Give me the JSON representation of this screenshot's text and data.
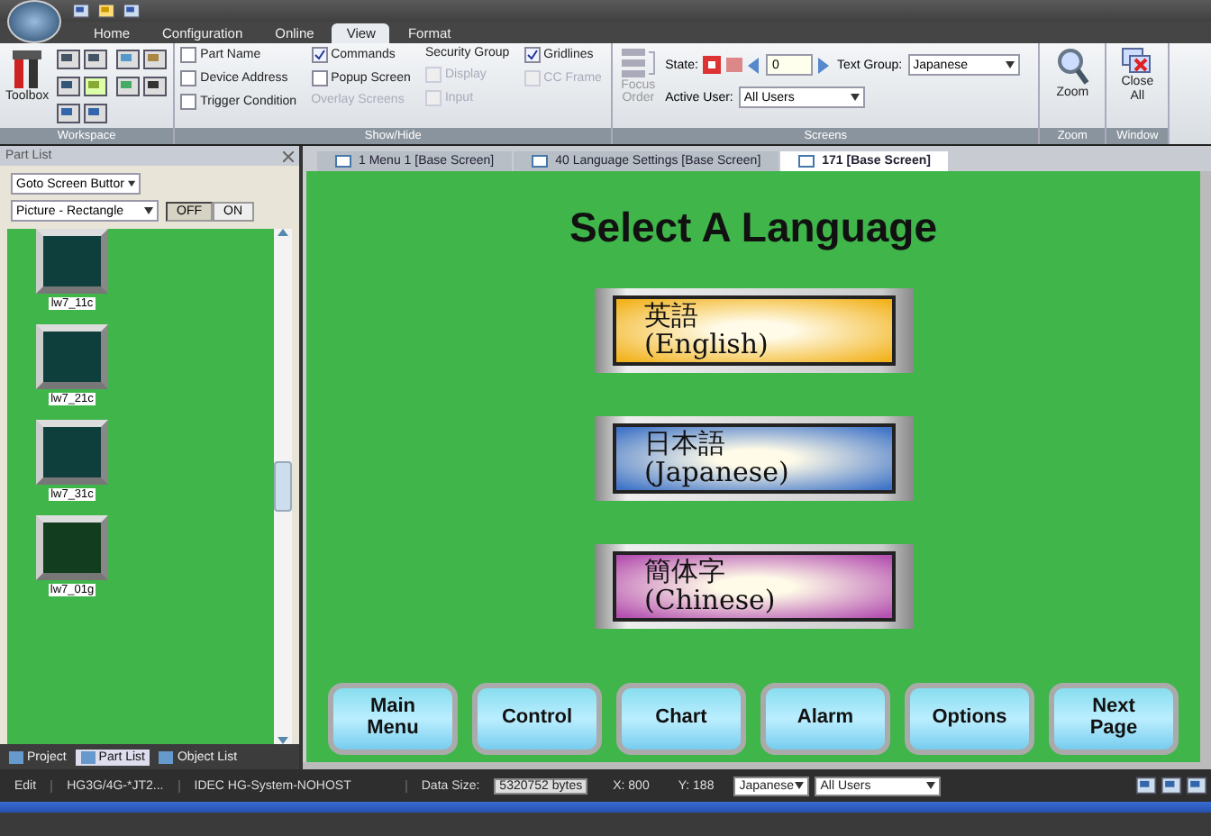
{
  "ribbon_tabs": [
    {
      "label": "Home",
      "selected": false
    },
    {
      "label": "Configuration",
      "selected": false
    },
    {
      "label": "Online",
      "selected": false
    },
    {
      "label": "View",
      "selected": true
    },
    {
      "label": "Format",
      "selected": false
    }
  ],
  "ribbon": {
    "workspace": {
      "toolbox": "Toolbox",
      "group_label": "Workspace"
    },
    "show_hide": {
      "group_label": "Show/Hide",
      "columns": [
        [
          {
            "kind": "checkbox",
            "label": "Part Name",
            "checked": false,
            "disabled": false
          },
          {
            "kind": "checkbox",
            "label": "Device Address",
            "checked": false,
            "disabled": false
          },
          {
            "kind": "checkbox",
            "label": "Trigger Condition",
            "checked": false,
            "disabled": false
          }
        ],
        [
          {
            "kind": "checkbox",
            "label": "Commands",
            "checked": true,
            "disabled": false
          },
          {
            "kind": "checkbox",
            "label": "Popup Screen",
            "checked": false,
            "disabled": false
          },
          {
            "kind": "label",
            "label": "Overlay Screens",
            "disabled": true
          }
        ],
        [
          {
            "kind": "label",
            "label": "Security Group",
            "disabled": false
          },
          {
            "kind": "checkbox",
            "label": "Display",
            "checked": false,
            "disabled": true
          },
          {
            "kind": "checkbox",
            "label": "Input",
            "checked": false,
            "disabled": true
          }
        ],
        [
          {
            "kind": "checkbox",
            "label": "Gridlines",
            "checked": true,
            "disabled": false
          },
          {
            "kind": "checkbox",
            "label": "CC Frame",
            "checked": false,
            "disabled": true
          }
        ]
      ]
    },
    "screens": {
      "group_label": "Screens",
      "focus_order": "Focus Order",
      "state_label": "State:",
      "state_value": "0",
      "text_group_label": "Text Group:",
      "text_group": "Japanese",
      "active_user_label": "Active User:",
      "active_user": "All Users"
    },
    "zoom": {
      "button": "Zoom",
      "group_label": "Zoom"
    },
    "window": {
      "button": "Close All",
      "group_label": "Window"
    }
  },
  "part_list": {
    "title": "Part List",
    "category": "Goto Screen Buttor",
    "shape": "Picture - Rectangle",
    "toggle": [
      {
        "label": "OFF",
        "selected": true
      },
      {
        "label": "ON",
        "selected": false
      }
    ],
    "parts": [
      {
        "name": "lw7_11c",
        "color": "#0f3f3c"
      },
      {
        "name": "lw7_21c",
        "color": "#0f3f3c"
      },
      {
        "name": "lw7_31c",
        "color": "#0f3f3c"
      },
      {
        "name": "lw7_01g",
        "color": "#123d1e"
      }
    ]
  },
  "panel_tabs": [
    {
      "label": "Project",
      "selected": false
    },
    {
      "label": "Part List",
      "selected": true
    },
    {
      "label": "Object List",
      "selected": false
    }
  ],
  "doc_tabs": [
    {
      "label": "1 Menu 1 [Base Screen]",
      "selected": false
    },
    {
      "label": "40 Language Settings [Base Screen]",
      "selected": false
    },
    {
      "label": "171  [Base Screen]",
      "selected": true
    }
  ],
  "screen": {
    "title": "Select A Language",
    "languages": [
      {
        "native": "英語",
        "english": "(English)",
        "color": "#f2b21c"
      },
      {
        "native": "日本語",
        "english": "(Japanese)",
        "color": "#3f74c8"
      },
      {
        "native": "簡体字",
        "english": "(Chinese)",
        "color": "#b450b0"
      }
    ],
    "nav_buttons": [
      [
        "Main",
        "Menu"
      ],
      [
        "Control"
      ],
      [
        "Chart"
      ],
      [
        "Alarm"
      ],
      [
        "Options"
      ],
      [
        "Next",
        "Page"
      ]
    ]
  },
  "status_bar": {
    "mode": "Edit",
    "model": "HG3G/4G-*JT2...",
    "system": "IDEC HG-System-NOHOST",
    "data_size_label": "Data Size:",
    "data_size": "5320752 bytes",
    "x": "X: 800",
    "y": "Y: 188",
    "language": "Japanese",
    "user": "All Users"
  }
}
